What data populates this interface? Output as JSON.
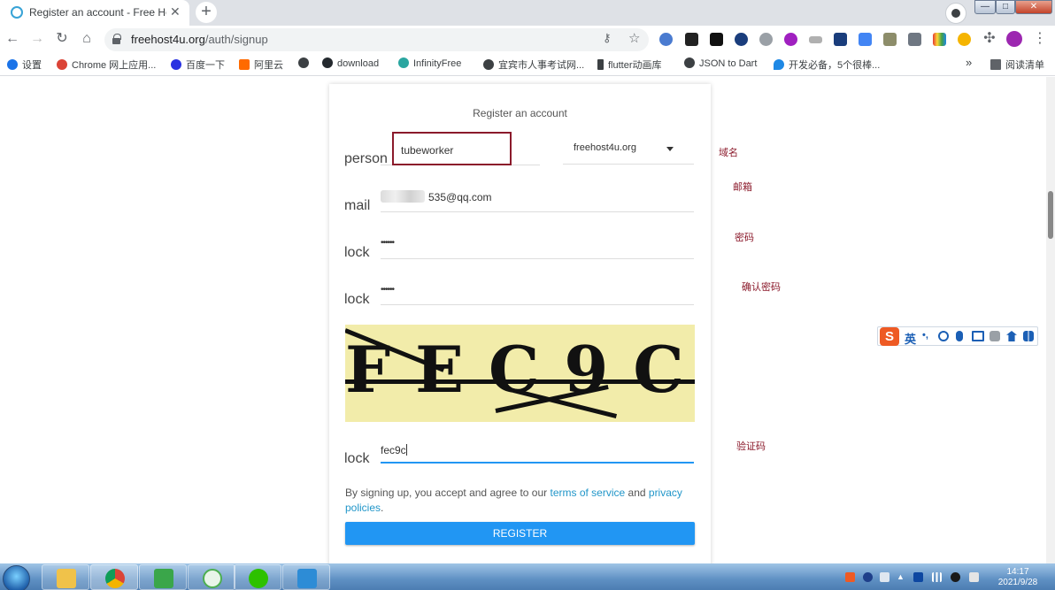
{
  "browser": {
    "tab_title": "Register an account - Free Ho",
    "tab_close": "✕",
    "new_tab": "+",
    "url_host": "freehost4u.org",
    "url_path": "/auth/signup",
    "window_min": "—",
    "window_max": "□",
    "window_close": "✕"
  },
  "bookmarks": [
    {
      "label": "设置",
      "color": "#1a73e8"
    },
    {
      "label": "Chrome 网上应用...",
      "color": "#db4437"
    },
    {
      "label": "百度一下",
      "color": "#2932e1"
    },
    {
      "label": "阿里云",
      "color": "#ff6a00"
    },
    {
      "label": "",
      "color": "#3c4043"
    },
    {
      "label": "download",
      "color": "#24292e"
    },
    {
      "label": "InfinityFree",
      "color": "#2aa6a0"
    },
    {
      "label": "宜宾市人事考试网...",
      "color": "#3c4043"
    },
    {
      "label": "flutter动画库",
      "color": "#3c4043"
    },
    {
      "label": "JSON to Dart",
      "color": "#3c4043"
    },
    {
      "label": "开发必备，5个很棒...",
      "color": "#1e88e5"
    }
  ],
  "bookmarks_more": "»",
  "reading_list": "阅读清单",
  "form": {
    "title": "Register an account",
    "username_label": "person",
    "username_value": "tubeworker",
    "domain_value": "freehost4u.org",
    "email_label": "mail",
    "email_value": "535@qq.com",
    "password_label": "lock",
    "password_value": "••••••",
    "confirm_label": "lock",
    "confirm_value": "••••••",
    "captcha_text": "FEC9C",
    "captcha_label": "lock",
    "captcha_value": "fec9c",
    "terms_prefix": "By signing up, you accept and agree to our ",
    "terms_link": "terms of service",
    "terms_and": " and ",
    "privacy_link": "privacy policies",
    "terms_suffix": ".",
    "register_label": "REGISTER"
  },
  "annotations": {
    "domain": "域名",
    "email": "邮箱",
    "password": "密码",
    "confirm": "确认密码",
    "captcha": "验证码"
  },
  "ime": {
    "lang": "英",
    "punct": "•,"
  },
  "taskbar": {
    "time": "14:17",
    "date": "2021/9/28"
  }
}
